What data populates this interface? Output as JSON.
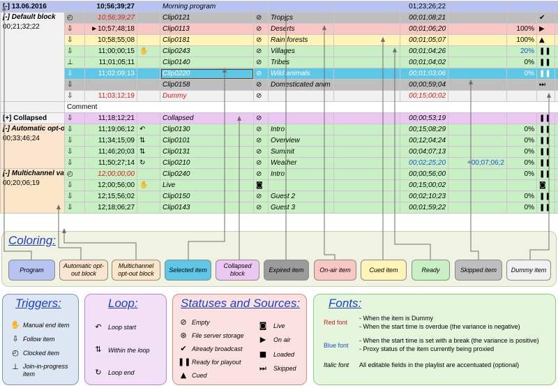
{
  "table": {
    "date_label": "[-] 13.06.2016",
    "program": {
      "time": "10;56;39;27",
      "name": "Morning program",
      "duration": "01;23;26;22"
    },
    "blocks": {
      "default": {
        "label": "[-] Default block",
        "duration": "00;21;32;22"
      },
      "collapsed": {
        "label": "[+] Collapsed"
      },
      "auto": {
        "label": "[-] Automatic opt-out block",
        "duration": "00;33;46;24"
      },
      "multi": {
        "label": "[-] Multichannel variation block",
        "duration": "00;20;06;19"
      }
    },
    "rows": [
      {
        "trg": "clock-icon",
        "trg_glyph": "◴",
        "time": "10;56;39;27",
        "loop": "",
        "name": "Clip0121",
        "src": "fileserver-icon",
        "e1": "Tropics",
        "e2": "",
        "dur": "00;01;08;21",
        "var": "",
        "pr": "",
        "st": "check-icon",
        "st_glyph": "✔"
      },
      {
        "trg": "follow-icon",
        "trg_glyph": "⇩",
        "time": "►10;57;48;18",
        "loop": "",
        "name": "Clip0113",
        "src": "fileserver-icon",
        "e1": "Deserts",
        "e2": "",
        "dur": "00;01;06;20",
        "var": "",
        "pr": "100%",
        "st": "onair-icon",
        "st_glyph": "▶"
      },
      {
        "trg": "follow-icon",
        "trg_glyph": "⇩",
        "time": "10;58;55;08",
        "loop": "",
        "name": "Clip0181",
        "src": "fileserver-icon",
        "e1": "Rain forests",
        "e2": "",
        "dur": "00;01;05;07",
        "var": "",
        "pr": "100%",
        "st": "cued-icon",
        "st_glyph": "▲"
      },
      {
        "trg": "follow-icon",
        "trg_glyph": "⇩",
        "time": "11;00;00;15",
        "loop": "✋",
        "name": "Clip0243",
        "src": "fileserver-icon",
        "e1": "Villages",
        "e2": "",
        "dur": "00;01;04;26",
        "var": "",
        "pr": "20%",
        "st": "ready-icon",
        "st_glyph": "❚❚"
      },
      {
        "trg": "join-icon",
        "trg_glyph": "⊥",
        "time": "11;01;05;11",
        "loop": "",
        "name": "Clip0140",
        "src": "fileserver-icon",
        "e1": "Tribes",
        "e2": "",
        "dur": "00;01;04;02",
        "var": "",
        "pr": "0%",
        "st": "ready-icon",
        "st_glyph": "❚❚"
      },
      {
        "trg": "follow-icon",
        "trg_glyph": "⇩",
        "time": "11;02;09;13",
        "loop": "",
        "name": "Clip0220",
        "src": "fileserver-icon",
        "e1": "Wild animals",
        "e2": "",
        "dur": "00;01;03;06",
        "var": "",
        "pr": "0%",
        "st": "ready-icon",
        "st_glyph": "❚❚"
      },
      {
        "trg": "follow-icon",
        "trg_glyph": "⇩",
        "time": "",
        "loop": "",
        "name": "Clip0158",
        "src": "fileserver-icon",
        "e1": "Domesticated anim",
        "e2": "",
        "dur": "00;00;59;04",
        "var": "",
        "pr": "",
        "st": "skipped-icon",
        "st_glyph": "⏭"
      },
      {
        "trg": "follow-icon",
        "trg_glyph": "⇩",
        "time": "11;03;12;19",
        "loop": "",
        "name": "Dummy",
        "src": "fileserver-icon",
        "e1": "",
        "e2": "",
        "dur": "00;15;00;02",
        "var": "",
        "pr": "",
        "st": "",
        "st_glyph": ""
      },
      {
        "comment": "Comment"
      },
      {
        "trg": "follow-icon",
        "trg_glyph": "⇩",
        "time": "11;18;12;21",
        "loop": "",
        "name": "Collapsed",
        "src": "fileserver-icon",
        "e1": "",
        "e2": "",
        "dur": "00;00;53;19",
        "var": "",
        "pr": "",
        "st": "ready-icon",
        "st_glyph": "❚❚"
      },
      {
        "trg": "follow-icon",
        "trg_glyph": "⇩",
        "time": "11;19;06;12",
        "loop": "↶",
        "name": "Clip0130",
        "src": "fileserver-icon",
        "e1": "Intro",
        "e2": "",
        "dur": "00;15;08;29",
        "var": "",
        "pr": "0%",
        "st": "ready-icon",
        "st_glyph": "❚❚"
      },
      {
        "trg": "follow-icon",
        "trg_glyph": "⇩",
        "time": "11;34;15;09",
        "loop": "⇅",
        "name": "Clip0101",
        "src": "fileserver-icon",
        "e1": "Overview",
        "e2": "",
        "dur": "00;12;04;24",
        "var": "",
        "pr": "0%",
        "st": "ready-icon",
        "st_glyph": "❚❚"
      },
      {
        "trg": "follow-icon",
        "trg_glyph": "⇩",
        "time": "11;46;20;03",
        "loop": "⇅",
        "name": "Clip0131",
        "src": "fileserver-icon",
        "e1": "Summit",
        "e2": "",
        "dur": "00;04;07;13",
        "var": "",
        "pr": "0%",
        "st": "ready-icon",
        "st_glyph": "❚❚"
      },
      {
        "trg": "follow-icon",
        "trg_glyph": "⇩",
        "time": "11;50;27;14",
        "loop": "↻",
        "name": "Clip0210",
        "src": "fileserver-icon",
        "e1": "Weather",
        "e2": "",
        "dur": "00;02;25;20",
        "var": "+00;07;06;2",
        "pr": "0%",
        "st": "ready-icon",
        "st_glyph": "❚❚"
      },
      {
        "trg": "clock-icon",
        "trg_glyph": "◴",
        "time": "12;00;00;00",
        "loop": "",
        "name": "Clip0240",
        "src": "fileserver-icon",
        "e1": "Intro",
        "e2": "",
        "dur": "00;00;56;00",
        "var": "",
        "pr": "0%",
        "st": "ready-icon",
        "st_glyph": "❚❚"
      },
      {
        "trg": "follow-icon",
        "trg_glyph": "⇩",
        "time": "12;00;56;00",
        "loop": "✋",
        "name": "Live",
        "src": "live-icon",
        "e1": "",
        "e2": "",
        "dur": "00;15;00;02",
        "var": "",
        "pr": "",
        "st": "live-icon",
        "st_glyph": "◙"
      },
      {
        "trg": "follow-icon",
        "trg_glyph": "⇩",
        "time": "12;15;56;02",
        "loop": "",
        "name": "Clip0150",
        "src": "fileserver-icon",
        "e1": "Guest 2",
        "e2": "",
        "dur": "00;02;10;23",
        "var": "",
        "pr": "0%",
        "st": "ready-icon",
        "st_glyph": "❚❚"
      },
      {
        "trg": "follow-icon",
        "trg_glyph": "⇩",
        "time": "12;18;06;27",
        "loop": "",
        "name": "Clip0143",
        "src": "fileserver-icon",
        "e1": "Guest 3",
        "e2": "",
        "dur": "00;01;59;22",
        "var": "",
        "pr": "0%",
        "st": "ready-icon",
        "st_glyph": "❚❚"
      }
    ]
  },
  "legend": {
    "coloring": {
      "title": "Coloring:",
      "chips": [
        {
          "label": "Program",
          "color": "#b7c3f1"
        },
        {
          "label": "Automatic opt-out block",
          "color": "#fbe5cf"
        },
        {
          "label": "Multichannel opt-out block",
          "color": "#fce6c8"
        },
        {
          "label": "Selected item",
          "color": "#5ec6e6"
        },
        {
          "label": "Collapsed block",
          "color": "#ecc7f4"
        },
        {
          "label": "Expired item",
          "color": "#9b9b9b"
        },
        {
          "label": "On-air item",
          "color": "#f8c6c3"
        },
        {
          "label": "Cued item",
          "color": "#fff4b8"
        },
        {
          "label": "Ready",
          "color": "#c9f0c4"
        },
        {
          "label": "Skipped item",
          "color": "#bebebe"
        },
        {
          "label": "Dummy item",
          "color": "#f1f1f1"
        }
      ]
    },
    "triggers": {
      "title": "Triggers:",
      "items": [
        {
          "icon": "manual-end-icon",
          "glyph": "✋",
          "label": "Manual end item"
        },
        {
          "icon": "follow-icon",
          "glyph": "⇩",
          "label": "Follow item"
        },
        {
          "icon": "clock-icon",
          "glyph": "◴",
          "label": "Clocked item"
        },
        {
          "icon": "join-icon",
          "glyph": "⊥",
          "label": "Join-in-progress item"
        }
      ]
    },
    "loop": {
      "title": "Loop:",
      "items": [
        {
          "icon": "loop-start-icon",
          "glyph": "↶",
          "label": "Loop start"
        },
        {
          "icon": "loop-within-icon",
          "glyph": "⇅",
          "label": "Within the loop"
        },
        {
          "icon": "loop-end-icon",
          "glyph": "↻",
          "label": "Loop end"
        }
      ]
    },
    "statuses": {
      "title": "Statuses and Sources:",
      "left": [
        {
          "icon": "empty-icon",
          "glyph": "⃠",
          "label": "Empty"
        },
        {
          "icon": "fileserver-icon",
          "glyph": "⊘",
          "label": "File server storage"
        },
        {
          "icon": "check-icon",
          "glyph": "✔",
          "label": "Already broadcast"
        },
        {
          "icon": "ready-icon",
          "glyph": "❚❚",
          "label": "Ready for playout"
        },
        {
          "icon": "cued-icon",
          "glyph": "▲",
          "label": "Cued"
        }
      ],
      "right": [
        {
          "icon": "live-icon",
          "glyph": "◙",
          "label": "Live"
        },
        {
          "icon": "onair-icon",
          "glyph": "▶",
          "label": "On air"
        },
        {
          "icon": "loaded-icon",
          "glyph": "■",
          "label": "Loaded"
        },
        {
          "icon": "skipped-icon",
          "glyph": "⏭",
          "label": "Skipped"
        }
      ]
    },
    "fonts": {
      "title": "Fonts:",
      "red_label": "Red font",
      "red_1": "- When the item is Dummy",
      "red_2": "- When the start time is overdue (the variance is negative)",
      "blue_label": "Blue font",
      "blue_1": "- When the start time is set with a break (the variance is positive)",
      "blue_2": "- Proxy status of the item currently being proxied",
      "italic_label": "Italic font",
      "italic_1": "All editable fields in the playlist are accentuated (optional)"
    }
  }
}
